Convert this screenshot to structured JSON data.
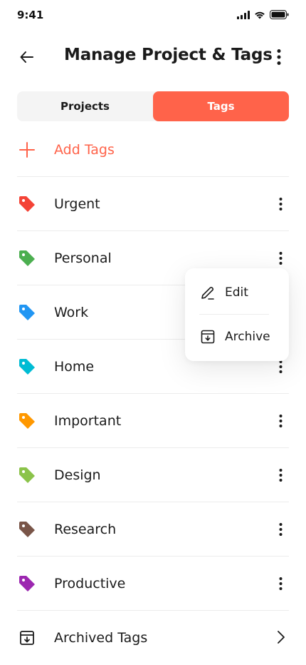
{
  "status_bar": {
    "time": "9:41"
  },
  "header": {
    "title": "Manage Project & Tags"
  },
  "segments": [
    {
      "label": "Projects",
      "active": false
    },
    {
      "label": "Tags",
      "active": true
    }
  ],
  "add_tags": {
    "label": "Add Tags"
  },
  "tags": [
    {
      "label": "Urgent",
      "color": "#f44336"
    },
    {
      "label": "Personal",
      "color": "#4caf50"
    },
    {
      "label": "Work",
      "color": "#2196f3"
    },
    {
      "label": "Home",
      "color": "#00bcd4"
    },
    {
      "label": "Important",
      "color": "#ff9800"
    },
    {
      "label": "Design",
      "color": "#8bc34a"
    },
    {
      "label": "Research",
      "color": "#795548"
    },
    {
      "label": "Productive",
      "color": "#9c27b0"
    }
  ],
  "archived": {
    "label": "Archived Tags"
  },
  "context_menu": {
    "edit_label": "Edit",
    "archive_label": "Archive"
  },
  "colors": {
    "accent": "#ff634a",
    "text": "#1b1b1b",
    "divider": "#ececec"
  }
}
